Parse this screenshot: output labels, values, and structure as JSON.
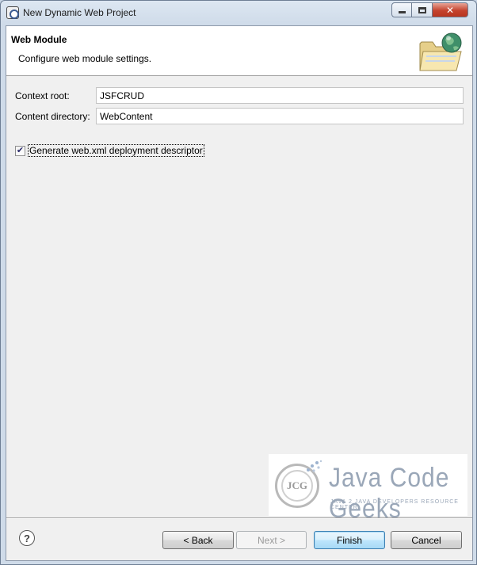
{
  "window": {
    "title": "New Dynamic Web Project"
  },
  "banner": {
    "title": "Web Module",
    "description": "Configure web module settings."
  },
  "form": {
    "context_root": {
      "label": "Context root:",
      "value": "JSFCRUD"
    },
    "content_directory": {
      "label": "Content directory:",
      "value": "WebContent"
    },
    "generate_descriptor": {
      "label": "Generate web.xml deployment descriptor",
      "checked": true
    }
  },
  "watermark": {
    "logo_text": "JCG",
    "brand": "Java Code Geeks",
    "tagline": "JAVA 2 JAVA DEVELOPERS RESOURCE CENTER"
  },
  "buttons": {
    "help": "?",
    "back": "< Back",
    "next": "Next >",
    "finish": "Finish",
    "cancel": "Cancel"
  },
  "icons": {
    "app": "eclipse-icon",
    "banner": "folder-globe-icon",
    "help": "help-icon"
  }
}
